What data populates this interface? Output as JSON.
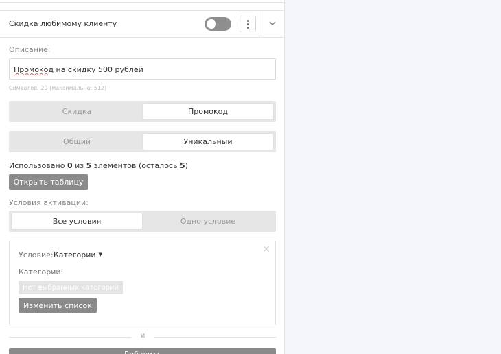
{
  "header": {
    "title": "Скидка любимому клиенту",
    "toggle_on": false
  },
  "description": {
    "label": "Описание:",
    "value_spellchecked": "Промокод",
    "value_rest": " на скидку 500 рублей",
    "counter": "Символов: 29 (максимально: 512)"
  },
  "type_switch": {
    "options": [
      "Скидка",
      "Промокод"
    ],
    "selected": "Промокод"
  },
  "code_switch": {
    "options": [
      "Общий",
      "Уникальный"
    ],
    "selected": "Уникальный"
  },
  "usage": {
    "prefix": "Использовано ",
    "used": "0",
    "middle": " из ",
    "total": "5",
    "suffix_open": " элементов (осталось ",
    "remaining": "5",
    "suffix_close": ")"
  },
  "open_table_button": "Открыть таблицу",
  "activation": {
    "label": "Условия активации:",
    "options": [
      "Все условия",
      "Одно условие"
    ],
    "selected": "Все условия"
  },
  "condition": {
    "label": "Условие:",
    "selected": "Категории",
    "categories_label": "Категории:",
    "empty_chip": "Нет выбранных категорий",
    "change_button": "Изменить список"
  },
  "separator_text": "и",
  "bottom_button": "Добавить",
  "colors": {
    "button_gray": "#8a8a8a",
    "segment_bg": "#e6e6e6",
    "page_bg": "#f4f6f9"
  }
}
